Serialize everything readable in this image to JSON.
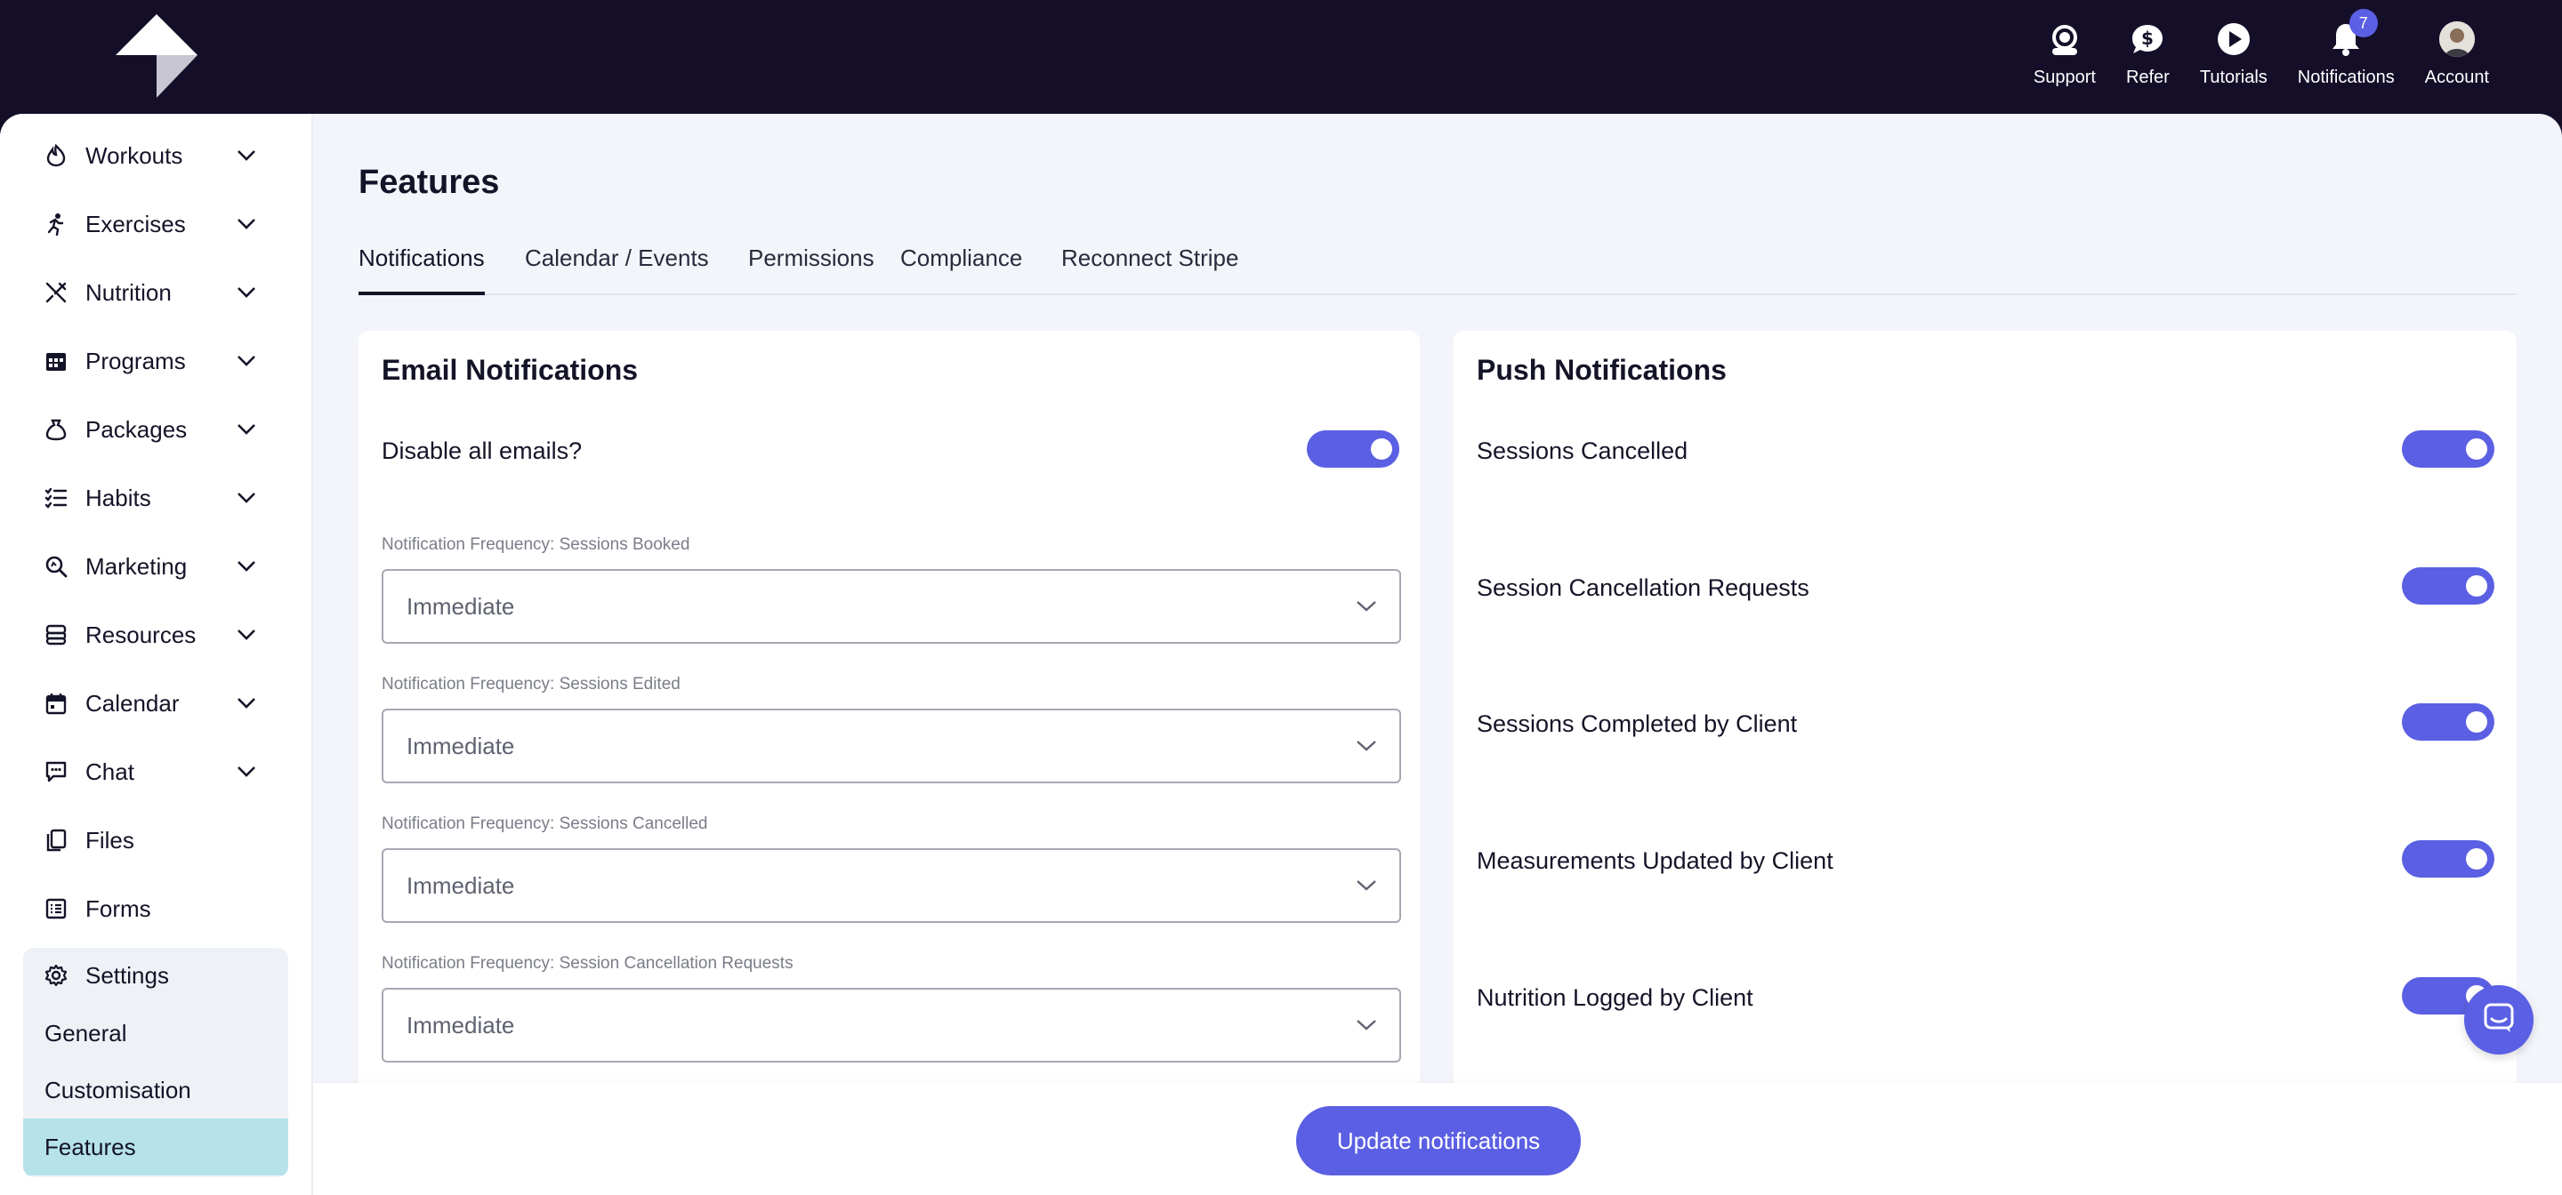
{
  "topnav": {
    "support": "Support",
    "refer": "Refer",
    "tutorials": "Tutorials",
    "notifications": "Notifications",
    "notifications_badge": "7",
    "account": "Account"
  },
  "sidebar": {
    "items": [
      {
        "label": "Workouts",
        "icon": "flame-icon"
      },
      {
        "label": "Exercises",
        "icon": "running-icon"
      },
      {
        "label": "Nutrition",
        "icon": "utensils-icon"
      },
      {
        "label": "Programs",
        "icon": "calendar-grid-icon"
      },
      {
        "label": "Packages",
        "icon": "money-bag-icon"
      },
      {
        "label": "Habits",
        "icon": "checklist-icon"
      },
      {
        "label": "Marketing",
        "icon": "search-magnify-icon"
      },
      {
        "label": "Resources",
        "icon": "database-icon"
      },
      {
        "label": "Calendar",
        "icon": "calendar-icon"
      },
      {
        "label": "Chat",
        "icon": "chat-icon"
      },
      {
        "label": "Files",
        "icon": "files-icon"
      },
      {
        "label": "Forms",
        "icon": "form-icon"
      }
    ],
    "settings": {
      "label": "Settings",
      "sub": [
        "General",
        "Customisation",
        "Features"
      ]
    }
  },
  "main": {
    "title": "Features",
    "tabs": [
      "Notifications",
      "Calendar / Events",
      "Permissions",
      "Compliance",
      "Reconnect Stripe"
    ]
  },
  "email": {
    "title": "Email Notifications",
    "disable_label": "Disable all emails?",
    "disable_on": true,
    "fields": [
      {
        "label": "Notification Frequency: Sessions Booked",
        "value": "Immediate"
      },
      {
        "label": "Notification Frequency: Sessions Edited",
        "value": "Immediate"
      },
      {
        "label": "Notification Frequency: Sessions Cancelled",
        "value": "Immediate"
      },
      {
        "label": "Notification Frequency: Session Cancellation Requests",
        "value": "Immediate"
      }
    ]
  },
  "push": {
    "title": "Push Notifications",
    "items": [
      {
        "label": "Sessions Cancelled",
        "on": true
      },
      {
        "label": "Session Cancellation Requests",
        "on": true
      },
      {
        "label": "Sessions Completed by Client",
        "on": true
      },
      {
        "label": "Measurements Updated by Client",
        "on": true
      },
      {
        "label": "Nutrition Logged by Client",
        "on": true
      }
    ]
  },
  "footer": {
    "update_label": "Update notifications"
  },
  "colors": {
    "accent": "#5b5fe3",
    "topbar": "#150e29",
    "active_sub": "#b6e2ec"
  }
}
